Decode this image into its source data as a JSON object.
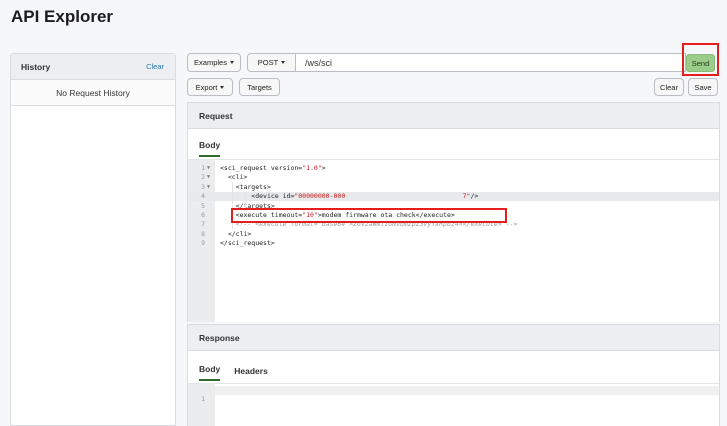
{
  "page": {
    "title": "API Explorer"
  },
  "history": {
    "title": "History",
    "clear_label": "Clear",
    "empty_text": "No Request History"
  },
  "toolbar": {
    "examples_label": "Examples",
    "method_label": "POST",
    "url_value": "/ws/sci",
    "send_label": "Send",
    "export_label": "Export",
    "targets_label": "Targets",
    "clear_label": "Clear",
    "save_label": "Save"
  },
  "request": {
    "title": "Request",
    "tab_body": "Body",
    "lines": [
      {
        "num": "1",
        "fold": "▼",
        "parts": [
          [
            "t",
            "<sci_request version="
          ],
          [
            "s",
            "\"1.0\""
          ],
          [
            "t",
            ">"
          ]
        ]
      },
      {
        "num": "2",
        "fold": "▼",
        "parts": [
          [
            "t",
            "  <cli>"
          ]
        ]
      },
      {
        "num": "3",
        "fold": "▼",
        "parts": [
          [
            "t",
            "    <targets>"
          ]
        ]
      },
      {
        "num": "4",
        "fold": "",
        "parts": [
          [
            "t",
            "        <device id="
          ],
          [
            "s",
            "\"00000000-000"
          ],
          [
            "t",
            "                              "
          ],
          [
            "s",
            "7\""
          ],
          [
            "t",
            "/>"
          ]
        ]
      },
      {
        "num": "5",
        "fold": "",
        "parts": [
          [
            "t",
            "    </targets>"
          ]
        ]
      },
      {
        "num": "6",
        "fold": "",
        "parts": [
          [
            "t",
            "    <execute timeout="
          ],
          [
            "s",
            "\"10\""
          ],
          [
            "t",
            ">modem firmware ota check</execute>"
          ]
        ]
      },
      {
        "num": "7",
        "fold": "",
        "parts": [
          [
            "c",
            "    <!-- <execute format=\"base64\">ZGV2aWNlIGNvbmZpZ3VyYXRpb24=</execute> -->"
          ]
        ]
      },
      {
        "num": "8",
        "fold": "",
        "parts": [
          [
            "t",
            "  </cli>"
          ]
        ]
      },
      {
        "num": "9",
        "fold": "",
        "parts": [
          [
            "t",
            "</sci_request>"
          ]
        ]
      }
    ]
  },
  "response": {
    "title": "Response",
    "tab_body": "Body",
    "tab_headers": "Headers",
    "line_num": "1"
  },
  "colors": {
    "send": "#9ccc8a",
    "highlight": "#e41d1d",
    "active_tab": "#2f6b2a",
    "string": "#c41a16"
  }
}
